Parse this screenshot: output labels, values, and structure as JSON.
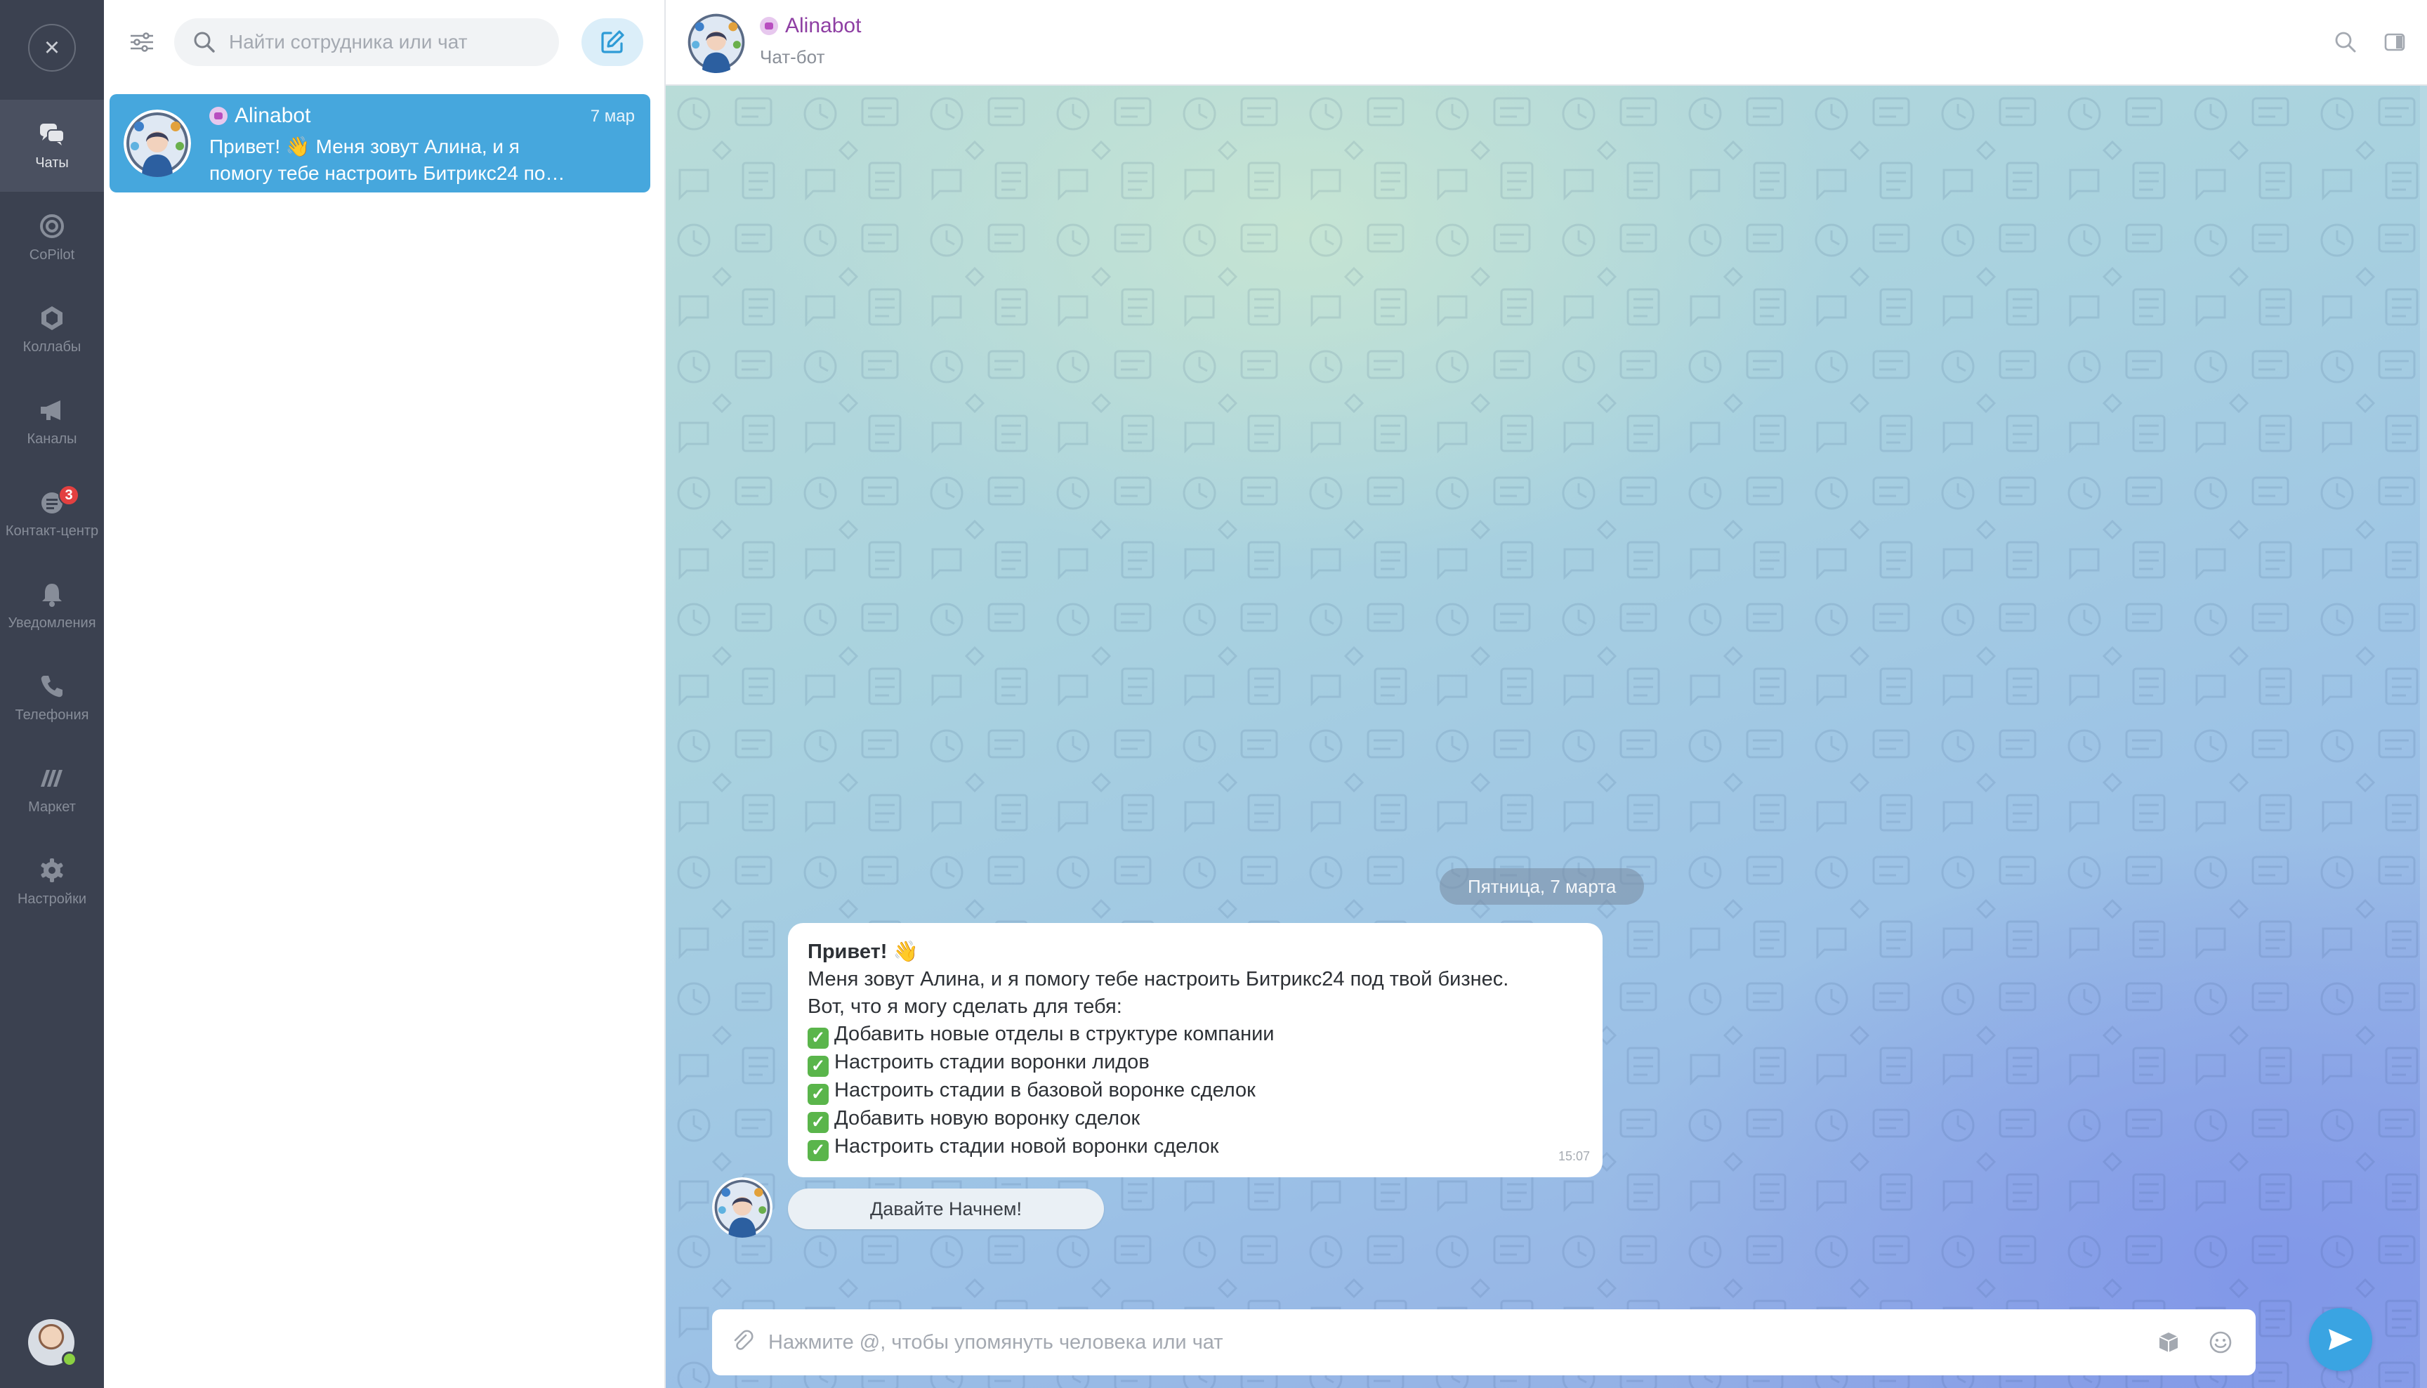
{
  "rail": {
    "close_symbol": "×",
    "items": [
      {
        "label": "Чаты",
        "icon": "chats-icon",
        "active": true
      },
      {
        "label": "CoPilot",
        "icon": "copilot-icon"
      },
      {
        "label": "Коллабы",
        "icon": "collabs-icon"
      },
      {
        "label": "Каналы",
        "icon": "megaphone-icon"
      },
      {
        "label": "Контакт-центр",
        "icon": "contact-center-icon",
        "badge": "3"
      },
      {
        "label": "Уведомления",
        "icon": "bell-icon"
      },
      {
        "label": "Телефония",
        "icon": "phone-icon"
      },
      {
        "label": "Маркет",
        "icon": "market-icon"
      },
      {
        "label": "Настройки",
        "icon": "gear-icon"
      }
    ]
  },
  "list": {
    "search_placeholder": "Найти сотрудника или чат",
    "chats": [
      {
        "name": "Alinabot",
        "date": "7 мар",
        "preview_line1": "Привет! 👋 Меня зовут Алина, и я",
        "preview_line2": "помогу тебе настроить Битрикс24 по…"
      }
    ]
  },
  "header": {
    "title": "Alinabot",
    "subtitle": "Чат-бот"
  },
  "conversation": {
    "date_divider": "Пятница, 7 марта",
    "message": {
      "greeting": "Привет! 👋",
      "line1": "Меня зовут Алина, и я помогу тебе настроить Битрикс24 под твой бизнес.",
      "line2": "Вот, что я могу сделать для тебя:",
      "check_symbol": "✓",
      "items": [
        "Добавить новые отделы в структуре компании",
        "Настроить стадии воронки лидов",
        "Настроить стадии в базовой воронке сделок",
        "Добавить новую воронку сделок",
        "Настроить стадии новой воронки сделок"
      ],
      "time": "15:07"
    },
    "keyboard_button": "Давайте Начнем!"
  },
  "composer": {
    "placeholder": "Нажмите @, чтобы упомянуть человека или чат"
  },
  "colors": {
    "rail_bg": "#3b4150",
    "accent": "#46a7dd",
    "bot_name": "#8e3fa3",
    "send": "#3aa4e2",
    "badge": "#e34040"
  }
}
